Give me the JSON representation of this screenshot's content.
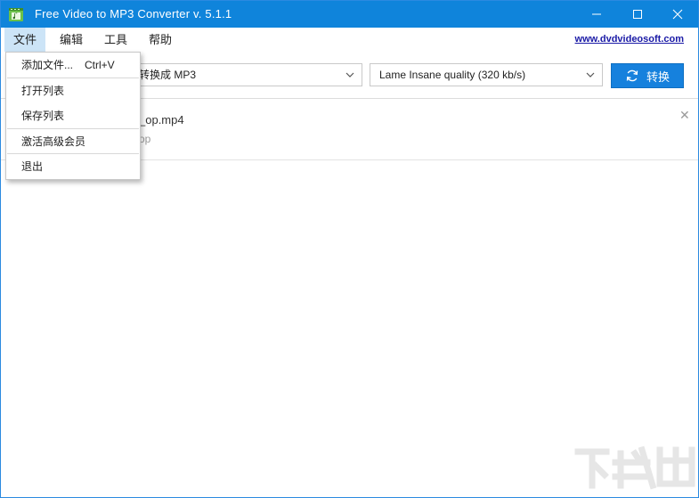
{
  "window": {
    "title": "Free Video to MP3 Converter v. 5.1.1",
    "accent_color": "#0f84db"
  },
  "menubar": {
    "items": [
      {
        "label": "文件"
      },
      {
        "label": "编辑"
      },
      {
        "label": "工具"
      },
      {
        "label": "帮助"
      }
    ],
    "website": "www.dvdvideosoft.com"
  },
  "file_menu": {
    "items": [
      {
        "label": "添加文件...",
        "shortcut": "Ctrl+V"
      },
      {
        "label": "打开列表"
      },
      {
        "label": "保存列表"
      },
      {
        "label": "激活高级会员"
      },
      {
        "label": "退出"
      }
    ]
  },
  "toolbar": {
    "format_select": "转换成 MP3",
    "quality_select": "Lame Insane quality (320 kb/s)",
    "convert_label": "转换"
  },
  "file_list": {
    "items": [
      {
        "name_visible": "_op.mp4",
        "sub_visible": "op"
      }
    ]
  },
  "icons": {
    "app": "app-film-icon",
    "minimize": "minimize-icon",
    "maximize": "maximize-icon",
    "close": "close-icon",
    "chevron": "chevron-down-icon",
    "refresh": "refresh-icon",
    "remove": "remove-x-icon"
  }
}
